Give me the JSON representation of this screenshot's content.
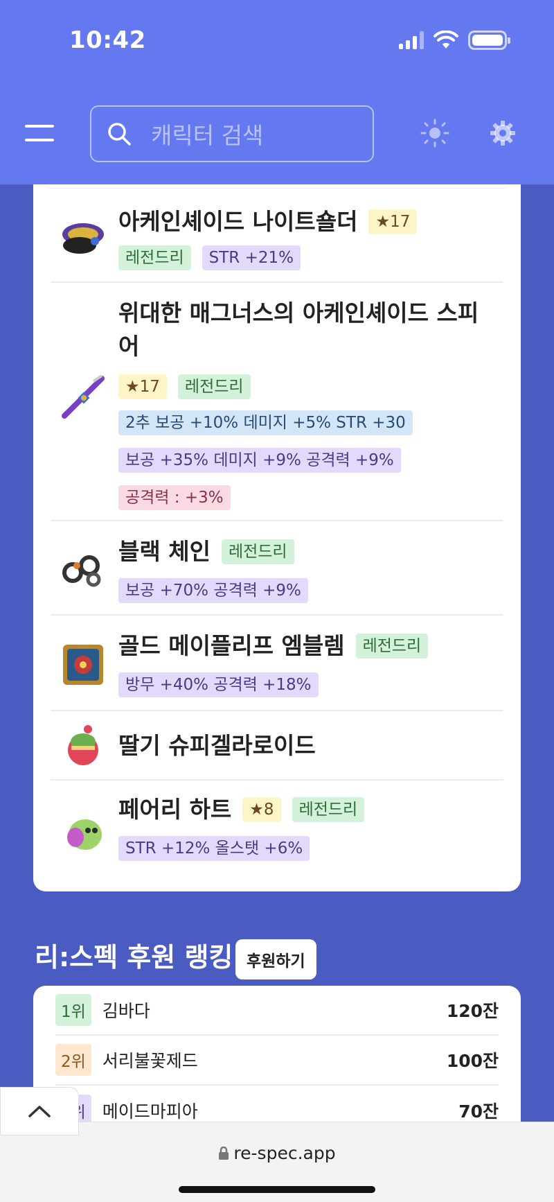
{
  "status": {
    "time": "10:42"
  },
  "header": {
    "search_placeholder": "캐릭터 검색"
  },
  "items": [
    {
      "name": "아케인셰이드 나이트숄더",
      "star": "17",
      "legend": "레전드리",
      "lines": [
        {
          "text": "STR +21%",
          "tone": "stat"
        }
      ]
    },
    {
      "name": "위대한 매그너스의 아케인셰이드 스피어",
      "star": "17",
      "legend": "레전드리",
      "lines": [
        {
          "text": "2추 보공 +10% 데미지 +5% STR +30",
          "tone": "blue"
        },
        {
          "text": "보공 +35% 데미지 +9% 공격력 +9%",
          "tone": "stat"
        },
        {
          "text": "공격력 : +3%",
          "tone": "pink"
        }
      ]
    },
    {
      "name": "블랙 체인",
      "star": "",
      "legend": "레전드리",
      "lines": [
        {
          "text": "보공 +70% 공격력 +9%",
          "tone": "stat"
        }
      ]
    },
    {
      "name": "골드 메이플리프 엠블렘",
      "star": "",
      "legend": "레전드리",
      "lines": [
        {
          "text": "방무 +40% 공격력 +18%",
          "tone": "stat"
        }
      ]
    },
    {
      "name": "딸기 슈피겔라로이드",
      "star": "",
      "legend": "",
      "lines": []
    },
    {
      "name": "페어리 하트",
      "star": "8",
      "legend": "레전드리",
      "lines": [
        {
          "text": "STR +12% 올스탯 +6%",
          "tone": "stat"
        }
      ]
    }
  ],
  "ranking": {
    "title": "리:스펙 후원 랭킹",
    "donate_label": "후원하기",
    "rows": [
      {
        "rank": "1위",
        "name": "김바다",
        "value": "120잔",
        "color": "#d4f2d9"
      },
      {
        "rank": "2위",
        "name": "서리불꽃제드",
        "value": "100잔",
        "color": "#fde8cf"
      },
      {
        "rank": "3위",
        "name": "메이드마피아",
        "value": "70잔",
        "color": "#e3d9fb"
      }
    ]
  },
  "browser": {
    "url": "re-spec.app"
  },
  "colors": {
    "header": "#6479f0",
    "background": "#4a5bc2"
  }
}
